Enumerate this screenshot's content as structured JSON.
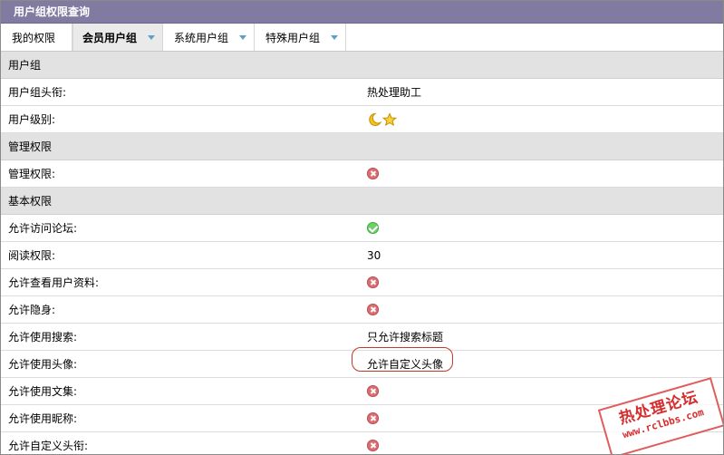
{
  "title": "用户组权限查询",
  "tabs": [
    {
      "label": "我的权限",
      "caret": false
    },
    {
      "label": "会员用户组",
      "caret": true,
      "active": true
    },
    {
      "label": "系统用户组",
      "caret": true
    },
    {
      "label": "特殊用户组",
      "caret": true
    }
  ],
  "rows": [
    {
      "type": "section",
      "key": "用户组"
    },
    {
      "type": "item",
      "key": "用户组头衔:",
      "value": "热处理助工"
    },
    {
      "type": "item",
      "key": "用户级别:",
      "icon": "level-moon-star-icon"
    },
    {
      "type": "section",
      "key": "管理权限"
    },
    {
      "type": "item",
      "key": "管理权限:",
      "icon": "deny-icon"
    },
    {
      "type": "section",
      "key": "基本权限"
    },
    {
      "type": "item",
      "key": "允许访问论坛:",
      "icon": "allow-check-icon"
    },
    {
      "type": "item",
      "key": "阅读权限:",
      "value": "30"
    },
    {
      "type": "item",
      "key": "允许查看用户资料:",
      "icon": "deny-icon"
    },
    {
      "type": "item",
      "key": "允许隐身:",
      "icon": "deny-icon"
    },
    {
      "type": "item",
      "key": "允许使用搜索:",
      "value": "只允许搜索标题"
    },
    {
      "type": "item",
      "key": "允许使用头像:",
      "value": "允许自定义头像"
    },
    {
      "type": "item",
      "key": "允许使用文集:",
      "icon": "deny-icon"
    },
    {
      "type": "item",
      "key": "允许使用昵称:",
      "icon": "deny-icon"
    },
    {
      "type": "item",
      "key": "允许自定义头衔:",
      "icon": "deny-icon"
    }
  ],
  "watermark": {
    "title": "热处理论坛",
    "url": "www.rclbbs.com"
  },
  "colors": {
    "titlebar": "#817ba2",
    "section": "#e2e2e2",
    "deny": "#d86f73",
    "allow": "#6fcf6a",
    "highlight": "#c0392b",
    "watermark": "#d62e2e"
  }
}
